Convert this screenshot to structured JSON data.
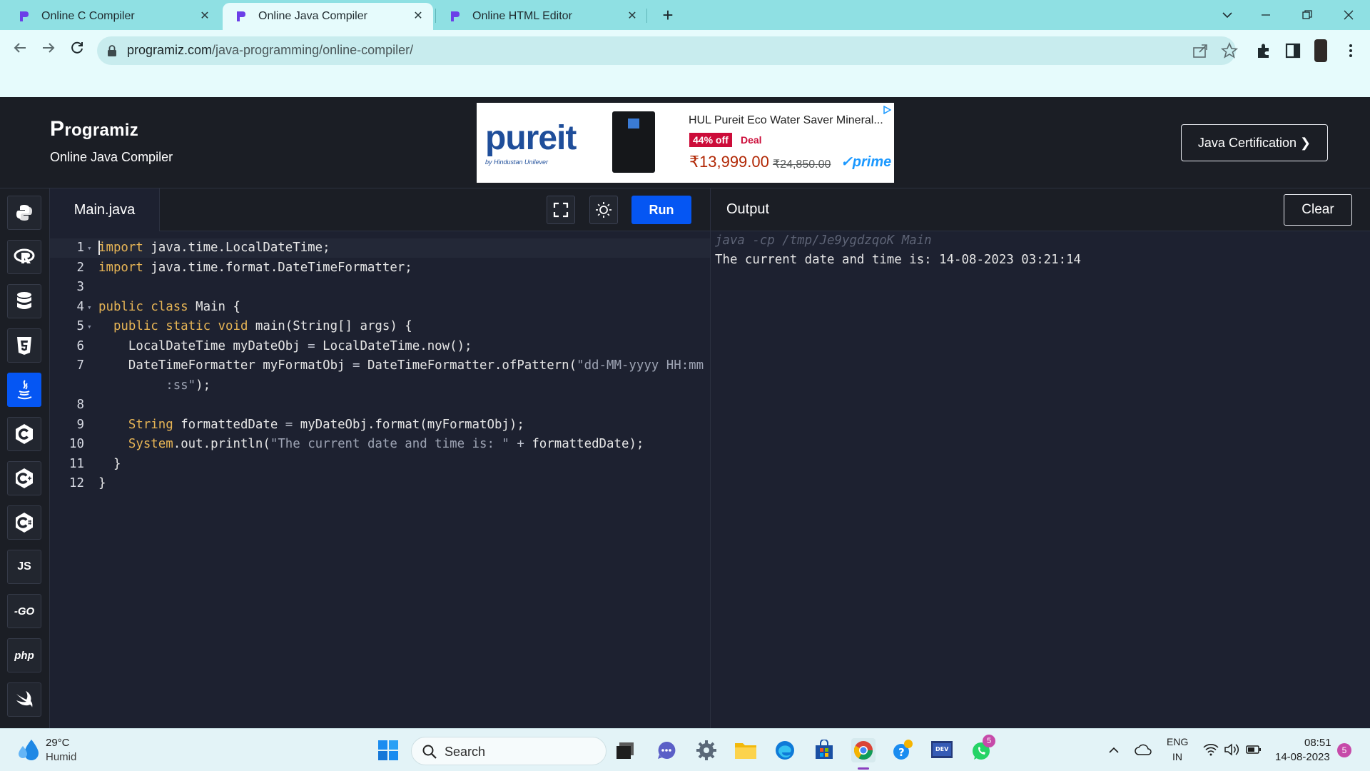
{
  "browser": {
    "tabs": [
      {
        "title": "Online C Compiler",
        "active": false
      },
      {
        "title": "Online Java Compiler",
        "active": true
      },
      {
        "title": "Online HTML Editor",
        "active": false
      }
    ],
    "close_glyph": "✕",
    "new_tab_glyph": "+",
    "url_host": "programiz.com",
    "url_path": "/java-programming/online-compiler/"
  },
  "site": {
    "logo_initial": "P",
    "logo_rest": "rogramiz",
    "subtitle": "Online Java Compiler",
    "certification_button": "Java Certification ❯"
  },
  "ad": {
    "brand": "pureit",
    "brand_sub": "by Hindustan Unilever",
    "title": "HUL Pureit Eco Water Saver Mineral...",
    "discount": "44% off",
    "deal": "Deal",
    "price": "₹13,999.00",
    "mrp": "₹24,850.00",
    "prime": "✓prime"
  },
  "sidebar": {
    "languages": [
      {
        "name": "python",
        "label": "",
        "active": false
      },
      {
        "name": "r",
        "label": "",
        "active": false
      },
      {
        "name": "sql",
        "label": "",
        "active": false
      },
      {
        "name": "html",
        "label": "",
        "active": false
      },
      {
        "name": "java",
        "label": "",
        "active": true
      },
      {
        "name": "c",
        "label": "",
        "active": false
      },
      {
        "name": "cpp",
        "label": "",
        "active": false
      },
      {
        "name": "csharp",
        "label": "",
        "active": false
      },
      {
        "name": "javascript",
        "label": "JS",
        "active": false
      },
      {
        "name": "go",
        "label": "-GO",
        "active": false
      },
      {
        "name": "php",
        "label": "php",
        "active": false
      },
      {
        "name": "swift",
        "label": "",
        "active": false
      }
    ]
  },
  "editor": {
    "file_name": "Main.java",
    "run_label": "Run",
    "lines": [
      {
        "n": "1",
        "fold": true,
        "tokens": [
          [
            "kw",
            "import"
          ],
          [
            "t",
            " java.time.LocalDateTime;"
          ]
        ]
      },
      {
        "n": "2",
        "fold": false,
        "tokens": [
          [
            "kw",
            "import"
          ],
          [
            "t",
            " java.time.format.DateTimeFormatter;"
          ]
        ]
      },
      {
        "n": "3",
        "fold": false,
        "tokens": []
      },
      {
        "n": "4",
        "fold": true,
        "tokens": [
          [
            "kw",
            "public class"
          ],
          [
            "t",
            " Main {"
          ]
        ]
      },
      {
        "n": "5",
        "fold": true,
        "tokens": [
          [
            "t",
            "  "
          ],
          [
            "kw",
            "public static void"
          ],
          [
            "t",
            " main(String[] args) {"
          ]
        ]
      },
      {
        "n": "6",
        "fold": false,
        "tokens": [
          [
            "t",
            "    LocalDateTime myDateObj "
          ],
          [
            "op",
            "="
          ],
          [
            "t",
            " LocalDateTime.now();"
          ]
        ]
      },
      {
        "n": "7",
        "fold": false,
        "tokens": [
          [
            "t",
            "    DateTimeFormatter myFormatObj "
          ],
          [
            "op",
            "="
          ],
          [
            "t",
            " DateTimeFormatter.ofPattern("
          ],
          [
            "str",
            "\"dd-MM-yyyy HH:mm"
          ]
        ]
      },
      {
        "n": "",
        "fold": false,
        "tokens": [
          [
            "str",
            "         :ss\""
          ],
          [
            "t",
            ");"
          ]
        ]
      },
      {
        "n": "8",
        "fold": false,
        "tokens": []
      },
      {
        "n": "9",
        "fold": false,
        "tokens": [
          [
            "t",
            "    "
          ],
          [
            "kw",
            "String"
          ],
          [
            "t",
            " formattedDate "
          ],
          [
            "op",
            "="
          ],
          [
            "t",
            " myDateObj.format(myFormatObj);"
          ]
        ]
      },
      {
        "n": "10",
        "fold": false,
        "tokens": [
          [
            "t",
            "    "
          ],
          [
            "kw",
            "System"
          ],
          [
            "t",
            ".out.println("
          ],
          [
            "str",
            "\"The current date and time is: \""
          ],
          [
            "t",
            " "
          ],
          [
            "op",
            "+"
          ],
          [
            "t",
            " formattedDate);"
          ]
        ]
      },
      {
        "n": "11",
        "fold": false,
        "tokens": [
          [
            "t",
            "  }"
          ]
        ]
      },
      {
        "n": "12",
        "fold": false,
        "tokens": [
          [
            "t",
            "}"
          ]
        ]
      }
    ]
  },
  "output": {
    "title": "Output",
    "clear_label": "Clear",
    "command": "java -cp /tmp/Je9ygdzqoK Main",
    "text": "The current date and time is: 14-08-2023 03:21:14"
  },
  "taskbar": {
    "temperature": "29°C",
    "weather": "Humid",
    "search_placeholder": "Search",
    "whatsapp_badge": "5",
    "lang_top": "ENG",
    "lang_bottom": "IN",
    "time": "08:51",
    "date": "14-08-2023",
    "notifications": "5"
  },
  "colors": {
    "accent": "#0556f3",
    "tabbar": "#8fe0e3",
    "editor_bg": "#1d2130",
    "keyword": "#e6b455"
  }
}
